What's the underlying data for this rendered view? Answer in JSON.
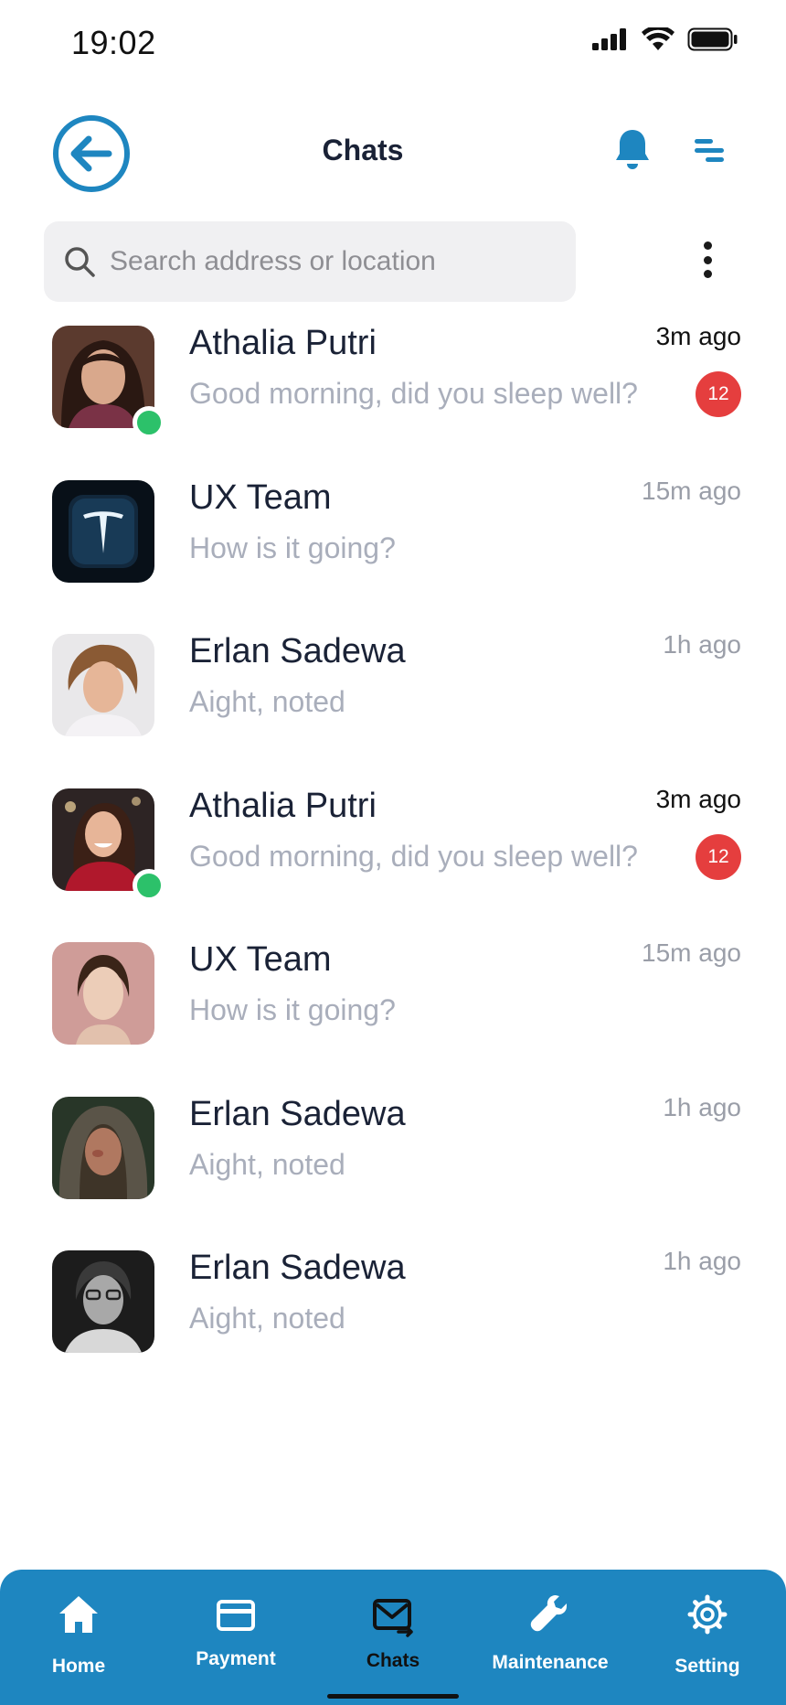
{
  "status_bar": {
    "time": "19:02"
  },
  "header": {
    "title": "Chats",
    "back_icon": "arrow-left-circle-icon",
    "notification_icon": "bell-icon",
    "menu_icon": "menu-icon"
  },
  "search": {
    "placeholder": "Search address or location",
    "icon": "search-icon"
  },
  "chats": [
    {
      "name": "Athalia Putri",
      "message": "Good morning, did you sleep well?",
      "time": "3m ago",
      "unread": "12",
      "online": true
    },
    {
      "name": "UX Team",
      "message": "How is it going?",
      "time": "15m ago",
      "unread": "",
      "online": false
    },
    {
      "name": "Erlan Sadewa",
      "message": "Aight, noted",
      "time": "1h ago",
      "unread": "",
      "online": false
    },
    {
      "name": "Athalia Putri",
      "message": "Good morning, did you sleep well?",
      "time": "3m ago",
      "unread": "12",
      "online": true
    },
    {
      "name": "UX Team",
      "message": "How is it going?",
      "time": "15m ago",
      "unread": "",
      "online": false
    },
    {
      "name": "Erlan Sadewa",
      "message": "Aight, noted",
      "time": "1h ago",
      "unread": "",
      "online": false
    },
    {
      "name": "Erlan Sadewa",
      "message": "Aight, noted",
      "time": "1h ago",
      "unread": "",
      "online": false
    }
  ],
  "nav": {
    "items": [
      {
        "label": "Home",
        "icon": "home-icon"
      },
      {
        "label": "Payment",
        "icon": "credit-card-icon"
      },
      {
        "label": "Chats",
        "icon": "mail-icon"
      },
      {
        "label": "Maintenance",
        "icon": "wrench-icon"
      },
      {
        "label": "Setting",
        "icon": "gear-icon"
      }
    ],
    "active": "Chats"
  },
  "colors": {
    "accent": "#1e86c0",
    "online": "#2cc16a",
    "badge": "#e53e3e",
    "muted_text": "#a9aebb"
  }
}
